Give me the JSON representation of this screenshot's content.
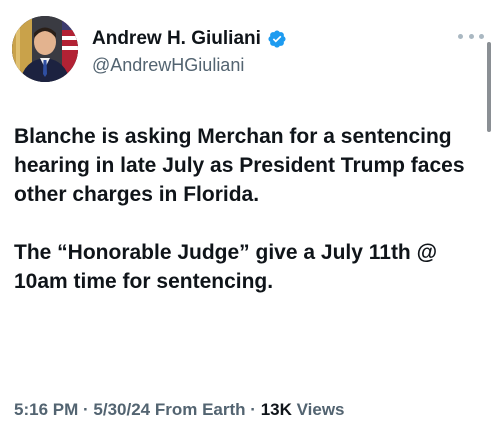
{
  "author": {
    "display_name": "Andrew H. Giuliani",
    "handle": "@AndrewHGiuliani",
    "verified": true
  },
  "tweet": {
    "paragraphs": [
      "Blanche is asking Merchan for a sentencing hearing in late July as President Trump faces other charges in Florida.",
      "The “Honorable Judge” give a July 11th @ 10am time for sentencing."
    ],
    "time": "5:16 PM",
    "separator": "·",
    "date": "5/30/24",
    "source": "From Earth",
    "views_count": "13K",
    "views_label": "Views"
  },
  "icons": {
    "verified": "verified-badge-icon",
    "more": "more-horizontal-icon"
  },
  "colors": {
    "verified_blue": "#1d9bf0",
    "text_primary": "#0f1419",
    "text_secondary": "#536471"
  }
}
